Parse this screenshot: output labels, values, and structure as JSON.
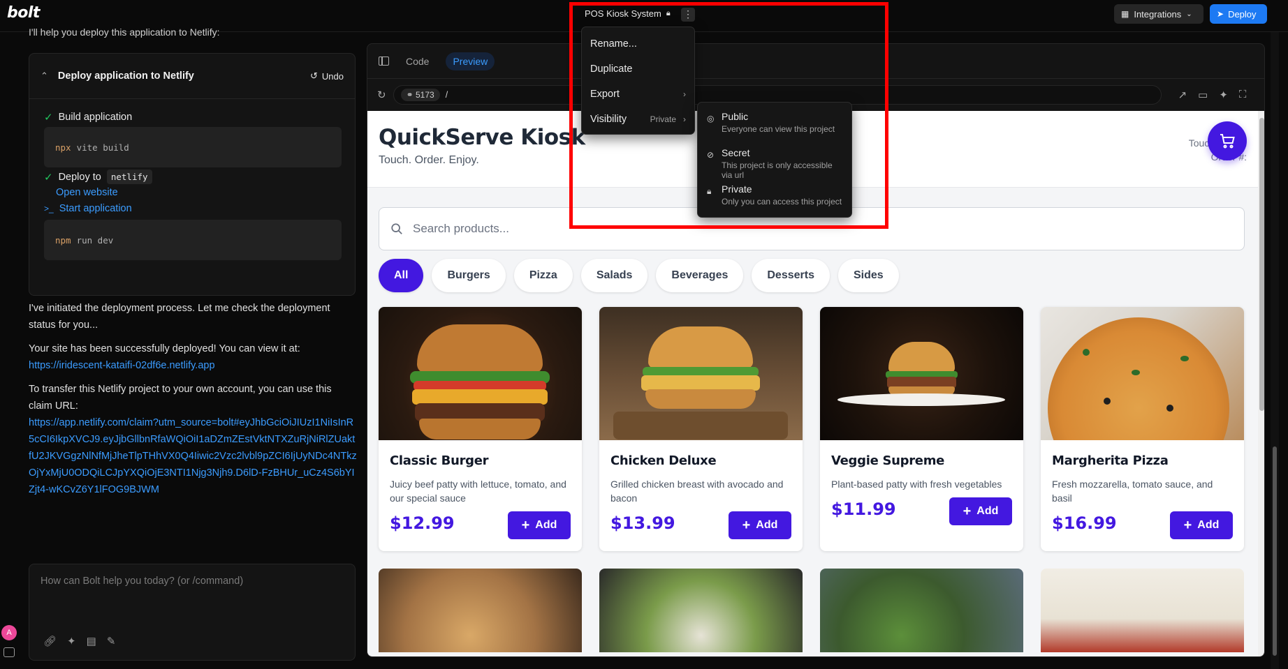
{
  "topbar": {
    "logo": "bolt",
    "project_title": "POS Kiosk System",
    "integrations_label": "Integrations",
    "deploy_label": "Deploy"
  },
  "chat": {
    "cut_text": "I'll help you deploy this application to Netlify:",
    "card_title": "Deploy application to Netlify",
    "undo_label": "Undo",
    "step_build": "Build application",
    "build_cmd": "npx",
    "build_arg": "vite build",
    "step_deploy_prefix": "Deploy to",
    "step_deploy_target": "netlify",
    "open_website": "Open website",
    "start_app": "Start application",
    "run_cmd": "npm",
    "run_arg": "run dev",
    "msg1": "I've initiated the deployment process. Let me check the deployment status for you...",
    "msg2_text": "Your site has been successfully deployed! You can view it at:",
    "msg2_link": "https://iridescent-kataifi-02df6e.netlify.app",
    "msg3_text": "To transfer this Netlify project to your own account, you can use  this claim URL:",
    "msg3_link": "https://app.netlify.com/claim?utm_source=bolt#eyJhbGciOiJIUzI1NiIsInR5cCI6IkpXVCJ9.eyJjbGllbnRfaWQiOiI1aDZmZEstVktNTXZuRjNiRlZUaktfU2JKVGgzNlNfMjJheTlpTHhVX0Q4Iiwic2Vzc2lvbl9pZCI6IjUyNDc4NTkzOjYxMjU0ODQiLCJpYXQiOjE3NTI1Njg3Njh9.D6lD-FzBHUr_uCz4S6bYIZjt4-wKCvZ6Y1lFOG9BJWM",
    "prompt_placeholder": "How can Bolt help you today? (or /command)",
    "avatar_letter": "A"
  },
  "workbench": {
    "tab_code": "Code",
    "tab_preview": "Preview",
    "port": "5173",
    "path": "/"
  },
  "menu": {
    "rename": "Rename...",
    "duplicate": "Duplicate",
    "export": "Export",
    "visibility": "Visibility",
    "visibility_value": "Private"
  },
  "visibility_options": [
    {
      "label": "Public",
      "desc": "Everyone can view this project",
      "icon": "globe-icon"
    },
    {
      "label": "Secret",
      "desc": "This project is only accessible via url",
      "icon": "eye-off-icon"
    },
    {
      "label": "Private",
      "desc": "Only you can access this project",
      "icon": "lock-icon"
    }
  ],
  "kiosk": {
    "title": "QuickServe Kiosk",
    "subtitle": "Touch. Order. Enjoy.",
    "right_line1": "Touch screen",
    "right_line2": "Order #:",
    "search_placeholder": "Search products...",
    "categories": [
      "All",
      "Burgers",
      "Pizza",
      "Salads",
      "Beverages",
      "Desserts",
      "Sides"
    ],
    "add_label": "Add",
    "products": [
      {
        "name": "Classic Burger",
        "desc": "Juicy beef patty with lettuce, tomato, and our special sauce",
        "price": "$12.99"
      },
      {
        "name": "Chicken Deluxe",
        "desc": "Grilled chicken breast with avocado and bacon",
        "price": "$13.99"
      },
      {
        "name": "Veggie Supreme",
        "desc": "Plant-based patty with fresh vegetables",
        "price": "$11.99"
      },
      {
        "name": "Margherita Pizza",
        "desc": "Fresh mozzarella, tomato sauce, and basil",
        "price": "$16.99"
      }
    ]
  },
  "colors": {
    "accent": "#4318e0",
    "bolt_blue": "#1d7af3",
    "highlight": "#ff0000"
  }
}
